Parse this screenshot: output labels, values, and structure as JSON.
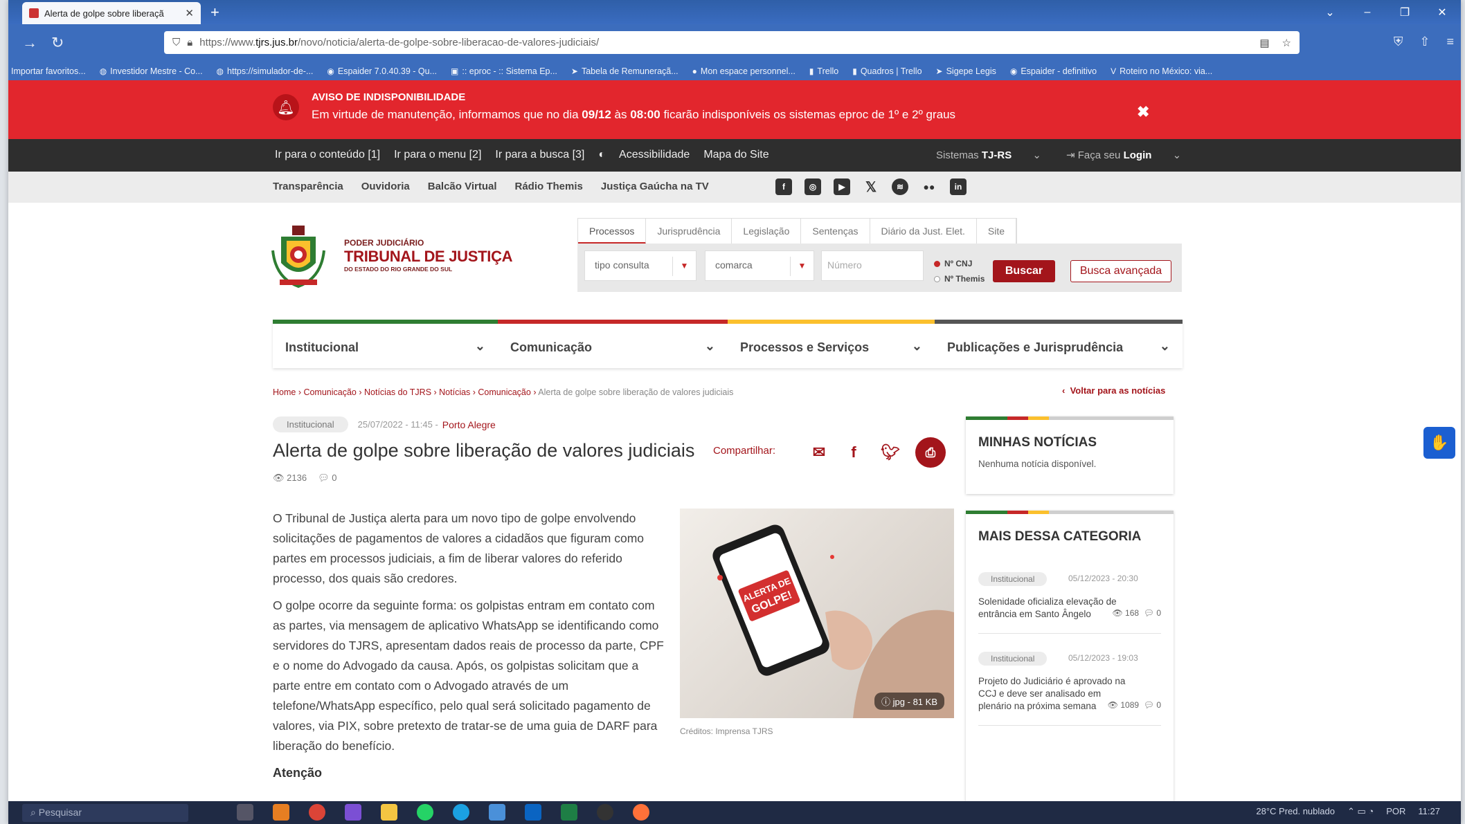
{
  "browser": {
    "tab_title": "Alerta de golpe sobre liberaçã",
    "url_prefix": "https://www.",
    "url_domain": "tjrs.jus.br",
    "url_path": "/novo/noticia/alerta-de-golpe-sobre-liberacao-de-valores-judiciais/",
    "bookmarks": [
      "Importar favoritos...",
      "Investidor Mestre - Co...",
      "https://simulador-de-...",
      "Espaider 7.0.40.39 - Qu...",
      ":: eproc - :: Sistema Ep...",
      "Tabela de Remuneraçã...",
      "Mon espace personnel...",
      "Trello",
      "Quadros | Trello",
      "Sigepe Legis",
      "Espaider - definitivo",
      "Roteiro no México: via..."
    ]
  },
  "alert": {
    "title": "AVISO DE INDISPONIBILIDADE",
    "msg_a": "Em virtude de manutenção, informamos que no dia ",
    "date": "09/12",
    "msg_b": " às ",
    "time": "08:00",
    "msg_c": " ficarão indisponíveis os sistemas eproc de 1º e 2º graus"
  },
  "accessibility": {
    "links": [
      "Ir para o conteúdo [1]",
      "Ir para o menu [2]",
      "Ir para a busca [3]"
    ],
    "contrast_icon": "contrast-icon",
    "acessibilidade": "Acessibilidade",
    "mapa": "Mapa do Site",
    "sistemas_label": "Sistemas",
    "sistemas_value": "TJ-RS",
    "login_pre": "Faça seu",
    "login": "Login"
  },
  "toplinks": [
    "Transparência",
    "Ouvidoria",
    "Balcão Virtual",
    "Rádio Themis",
    "Justiça Gaúcha na TV"
  ],
  "brand": {
    "line1": "PODER JUDICIÁRIO",
    "line2": "TRIBUNAL DE JUSTIÇA",
    "line3": "DO ESTADO DO RIO GRANDE DO SUL"
  },
  "search": {
    "tabs": [
      "Processos",
      "Jurisprudência",
      "Legislação",
      "Sentenças",
      "Diário da Just. Elet.",
      "Site"
    ],
    "tipo": "tipo consulta",
    "comarca": "comarca",
    "numero_placeholder": "Número",
    "radio1": "Nº CNJ",
    "radio2": "Nº Themis",
    "buscar": "Buscar",
    "avancada": "Busca avançada"
  },
  "menu": [
    "Institucional",
    "Comunicação",
    "Processos e Serviços",
    "Publicações e Jurisprudência"
  ],
  "menu_colors": [
    "#2e7d32",
    "#c62828",
    "#fbc02d",
    "#555555"
  ],
  "breadcrumb": {
    "items": [
      "Home",
      "Comunicação",
      "Notícias do TJRS",
      "Notícias",
      "Comunicação"
    ],
    "current": "Alerta de golpe sobre liberação de valores judiciais",
    "back": "Voltar para as notícias"
  },
  "article": {
    "category": "Institucional",
    "date": "25/07/2022 - 11:45 -",
    "location": "Porto Alegre",
    "title": "Alerta de golpe sobre liberação de valores judiciais",
    "share": "Compartilhar:",
    "views": "2136",
    "comments": "0",
    "p1": "O Tribunal de Justiça alerta para um novo tipo de golpe envolvendo solicitações de pagamentos de valores a cidadãos que figuram como partes em processos judiciais, a fim de liberar valores do referido processo, dos quais são credores.",
    "p2": "O golpe ocorre da seguinte forma: os golpistas entram em contato com as partes, via mensagem de aplicativo WhatsApp se identificando como servidores do TJRS, apresentam dados reais de processo da parte, CPF e o nome do Advogado da causa. Após, os golpistas solicitam que a parte entre em contato com o Advogado através de um telefone/WhatsApp específico, pelo qual será solicitado pagamento de valores, via PIX, sobre pretexto de tratar-se de uma guia de DARF para liberação do benefício.",
    "h_atencao": "Atenção",
    "image_text": "ALERTA DE GOLPE!",
    "image_size": "jpg - 81 KB",
    "credit": "Créditos: Imprensa TJRS"
  },
  "sidebar": {
    "my_title": "MINHAS NOTÍCIAS",
    "my_empty": "Nenhuma notícia disponível.",
    "more_title": "MAIS DESSA CATEGORIA",
    "items": [
      {
        "category": "Institucional",
        "date": "05/12/2023 - 20:30",
        "title": "Solenidade oficializa elevação de entrância em Santo Ângelo",
        "views": "168",
        "comments": "0"
      },
      {
        "category": "Institucional",
        "date": "05/12/2023 - 19:03",
        "title": "Projeto do Judiciário é aprovado na CCJ e deve ser analisado em plenário na próxima semana",
        "views": "1089",
        "comments": "0"
      }
    ]
  },
  "taskbar": {
    "search": "Pesquisar",
    "weather": "28°C  Pred. nublado",
    "lang": "POR",
    "time": "11:27"
  }
}
